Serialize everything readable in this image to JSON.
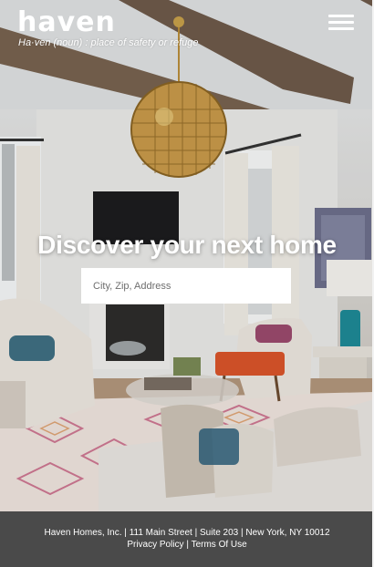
{
  "brand": {
    "logo": "haven",
    "tagline": "Ha·ven (noun) : place of safety or refuge"
  },
  "header": {
    "menu_icon": "hamburger-menu-icon"
  },
  "hero": {
    "headline": "Discover your next home"
  },
  "search": {
    "placeholder": "City, Zip, Address",
    "value": ""
  },
  "footer": {
    "company": "Haven Homes, Inc.",
    "street": "111 Main Street",
    "suite": "Suite 203",
    "city": "New York, NY 10012",
    "separator": "|",
    "privacy_label": "Privacy Policy",
    "terms_label": "Terms Of Use"
  },
  "colors": {
    "footer_bg": "#4a4a4a",
    "text_on_dark": "#ffffff",
    "lamp_teal": "#1e8a96",
    "ottoman_orange": "#d9542a"
  }
}
